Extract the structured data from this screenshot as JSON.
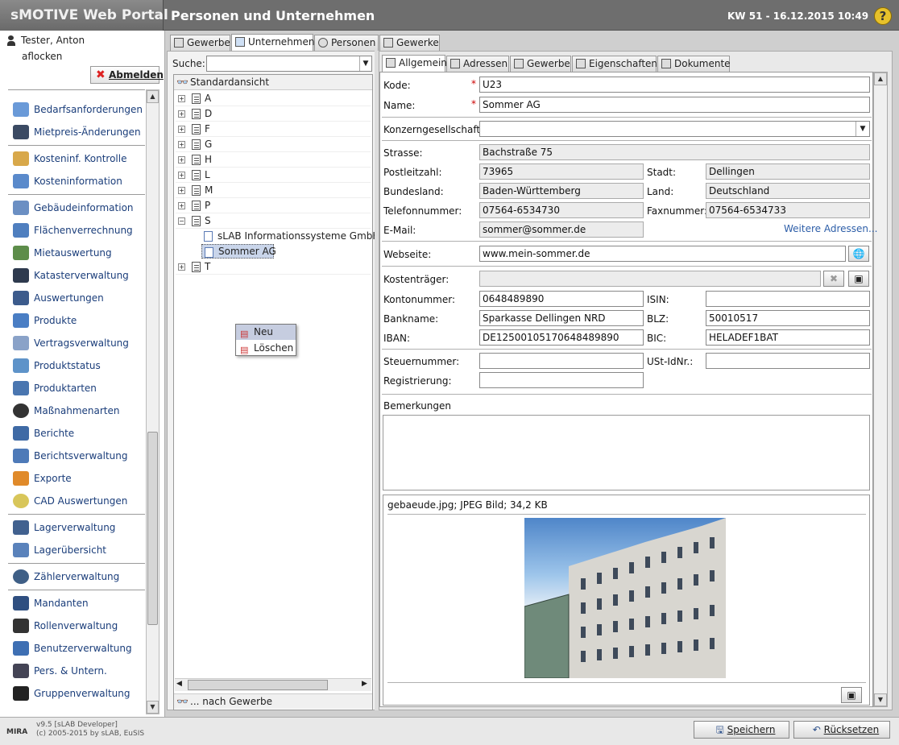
{
  "header": {
    "app_title": "sMOTIVE Web Portal",
    "page_title": "Personen und Unternehmen",
    "week_date": "KW 51 - 16.12.2015 10:49",
    "help_label": "?"
  },
  "user": {
    "name": "Tester, Anton",
    "login": "aflocken",
    "logout_label": "Abmelden"
  },
  "sidebar": {
    "items": [
      {
        "label": "Bedarfsanforderungen",
        "icon": "hand-pointer-icon"
      },
      {
        "label": "Mietpreis-Änderungen",
        "icon": "tray-icon"
      },
      {
        "label": "Kosteninf. Kontrolle",
        "icon": "coins-gear-icon"
      },
      {
        "label": "Kosteninformation",
        "icon": "coins-icon"
      },
      {
        "label": "Gebäudeinformation",
        "icon": "building-icon"
      },
      {
        "label": "Flächenverrechnung",
        "icon": "area-calc-icon"
      },
      {
        "label": "Mietauswertung",
        "icon": "house-chart-icon"
      },
      {
        "label": "Katasterverwaltung",
        "icon": "cylinder-icon"
      },
      {
        "label": "Auswertungen",
        "icon": "bar-chart-icon"
      },
      {
        "label": "Produkte",
        "icon": "product-icon"
      },
      {
        "label": "Vertragsverwaltung",
        "icon": "contract-icon"
      },
      {
        "label": "Produktstatus",
        "icon": "product-status-icon"
      },
      {
        "label": "Produktarten",
        "icon": "product-types-icon"
      },
      {
        "label": "Maßnahmenarten",
        "icon": "gear-icon"
      },
      {
        "label": "Berichte",
        "icon": "report-icon"
      },
      {
        "label": "Berichtsverwaltung",
        "icon": "report-admin-icon"
      },
      {
        "label": "Exporte",
        "icon": "export-icon"
      },
      {
        "label": "CAD Auswertungen",
        "icon": "cad-icon"
      },
      {
        "label": "Lagerverwaltung",
        "icon": "warehouse-icon"
      },
      {
        "label": "Lagerübersicht",
        "icon": "warehouse-overview-icon"
      },
      {
        "label": "Zählerverwaltung",
        "icon": "meter-icon"
      },
      {
        "label": "Mandanten",
        "icon": "clients-icon"
      },
      {
        "label": "Rollenverwaltung",
        "icon": "masks-icon"
      },
      {
        "label": "Benutzerverwaltung",
        "icon": "users-icon"
      },
      {
        "label": "Pers. & Untern.",
        "icon": "person-company-icon"
      },
      {
        "label": "Gruppenverwaltung",
        "icon": "group-icon"
      }
    ]
  },
  "footer": {
    "version": "v9.5 [sLAB Developer]",
    "copyright": "(c) 2005-2015 by sLAB, EuSIS",
    "logo": "MIRA",
    "save_label": "Speichern",
    "reset_label": "Rücksetzen"
  },
  "top_tabs": [
    "Gewerbe",
    "Unternehmen",
    "Personen",
    "Gewerke"
  ],
  "tree": {
    "search_label": "Suche:",
    "header": "Standardansicht",
    "footer": "... nach Gewerbe",
    "nodes": [
      "A",
      "D",
      "F",
      "G",
      "H",
      "L",
      "M",
      "P",
      "S",
      "T"
    ],
    "children_s": [
      "sLAB Informationssysteme GmbH",
      "Sommer AG"
    ],
    "context_menu": [
      "Neu",
      "Löschen"
    ]
  },
  "detail_tabs": [
    "Allgemein",
    "Adressen",
    "Gewerbe",
    "Eigenschaften",
    "Dokumente"
  ],
  "form": {
    "kode_label": "Kode:",
    "kode": "U23",
    "name_label": "Name:",
    "name": "Sommer AG",
    "konzern_label": "Konzerngesellschaft:",
    "konzern": "",
    "strasse_label": "Strasse:",
    "strasse": "Bachstraße 75",
    "plz_label": "Postleitzahl:",
    "plz": "73965",
    "stadt_label": "Stadt:",
    "stadt": "Dellingen",
    "bundesland_label": "Bundesland:",
    "bundesland": "Baden-Württemberg",
    "land_label": "Land:",
    "land": "Deutschland",
    "tel_label": "Telefonnummer:",
    "tel": "07564-6534730",
    "fax_label": "Faxnummer:",
    "fax": "07564-6534733",
    "email_label": "E-Mail:",
    "email": "sommer@sommer.de",
    "more_addresses": "Weitere Adressen...",
    "web_label": "Webseite:",
    "web": "www.mein-sommer.de",
    "kostentraeger_label": "Kostenträger:",
    "kostentraeger": "",
    "konto_label": "Kontonummer:",
    "konto": "0648489890",
    "isin_label": "ISIN:",
    "isin": "",
    "bank_label": "Bankname:",
    "bank": "Sparkasse Dellingen NRD",
    "blz_label": "BLZ:",
    "blz": "50010517",
    "iban_label": "IBAN:",
    "iban": "DE12500105170648489890",
    "bic_label": "BIC:",
    "bic": "HELADEF1BAT",
    "steuer_label": "Steuernummer:",
    "steuer": "",
    "ust_label": "USt-IdNr.:",
    "ust": "",
    "reg_label": "Registrierung:",
    "reg": "",
    "bem_label": "Bemerkungen",
    "image_info": "gebaeude.jpg; JPEG Bild; 34,2 KB",
    "required_mark": "*"
  }
}
